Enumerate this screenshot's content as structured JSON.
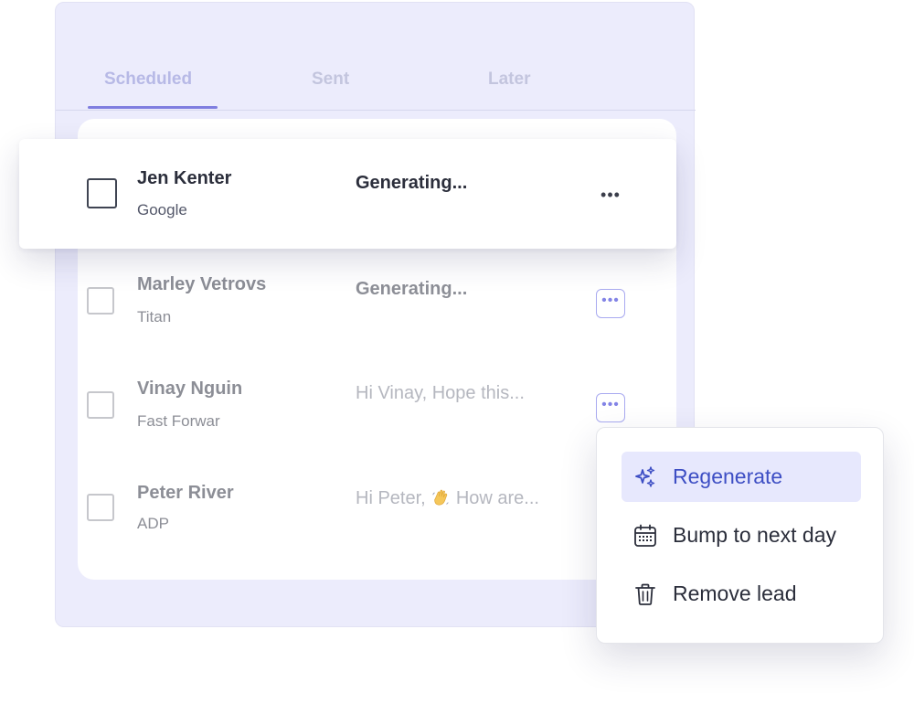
{
  "tabs": [
    {
      "label": "Scheduled",
      "active": true
    },
    {
      "label": "Sent",
      "active": false
    },
    {
      "label": "Later",
      "active": false
    }
  ],
  "leads": [
    {
      "name": "Jen Kenter",
      "company": "Google",
      "preview": "Generating...",
      "selected_row": true
    },
    {
      "name": "Marley Vetrovs",
      "company": "Titan",
      "preview": "Generating..."
    },
    {
      "name": "Vinay Nguin",
      "company": "Fast Forwar",
      "preview": "Hi Vinay, Hope this..."
    },
    {
      "name": "Peter River",
      "company": "ADP",
      "preview_start": "Hi Peter,",
      "preview_emoji": "waving-hand-icon",
      "preview_end": "How are..."
    }
  ],
  "menu": {
    "items": [
      {
        "label": "Regenerate",
        "icon": "sparkles-icon",
        "active": true
      },
      {
        "label": "Bump to next day",
        "icon": "calendar-icon"
      },
      {
        "label": "Remove lead",
        "icon": "trash-icon"
      }
    ]
  },
  "more_glyph": "•••",
  "colors": {
    "panel": "#ececfc",
    "accent": "#7f7ee0",
    "menu_active_bg": "#e7e8fd",
    "menu_active_text": "#3d4ec4"
  }
}
